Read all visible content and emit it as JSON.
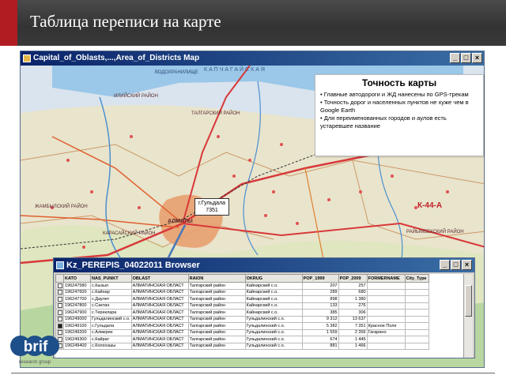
{
  "slide": {
    "title": "Таблица переписи на карте"
  },
  "map_window": {
    "title": "Capital_of_Oblasts,...,Area_of_Districts Map",
    "buttons": [
      "_",
      "□",
      "×"
    ],
    "labels": {
      "region1": "КАПЧАГАЙСКАЯ",
      "region2": "ИЛИЙСКИЙ РАЙОН",
      "region3": "ТАЛГАРСКИЙ РАЙОН",
      "region4": "ЖАМБЫЛСКИЙ РАЙОН",
      "region5": "КАРАСАЙСКИЙ РАЙОН",
      "region6": "РАЙЫМБЕКСКИЙ РАЙОН",
      "city": "АЛМАТЫ",
      "lake": "ВОДОХРАНИЛИЩЕ"
    },
    "road_label": "К-44-А",
    "callout": {
      "line1": "г.Гульдала",
      "line2": "7351"
    }
  },
  "accuracy_note": {
    "title": "Точность карты",
    "bullets": [
      "Главные автодороги и ЖД нанесены по GPS-трекам",
      "Точность дорог и населенных пунктов не хуже чем в Google Earth",
      "Для переименованных городов и аулов есть устаревшее название"
    ]
  },
  "browser_window": {
    "title": "Kz_PEREPIS_04022011 Browser",
    "buttons": [
      "_",
      "□",
      "×"
    ],
    "columns": [
      "KATO",
      "NAS_PUNKT",
      "OBLAST",
      "RAION",
      "OKRUG",
      "POP_1999",
      "POP_2009",
      "FORMERNAME",
      "City_Type"
    ],
    "rows": [
      [
        "196247580",
        "с.Кызыл",
        "АЛМАТИНСКАЯ ОБЛАСТ",
        "Талгарский район",
        "Кайнарский с.о.",
        "207",
        "257",
        "",
        ""
      ],
      [
        "196247600",
        "с.Кайнар",
        "АЛМАТИНСКАЯ ОБЛАСТ",
        "Талгарский район",
        "Кайнарский с.о.",
        "289",
        "680",
        "",
        ""
      ],
      [
        "196247700",
        "с.Даулет",
        "АЛМАТИНСКАЯ ОБЛАСТ",
        "Талгарский район",
        "Кайнарский с.о.",
        "898",
        "1 380",
        "",
        ""
      ],
      [
        "196247800",
        "с.Сактан",
        "АЛМАТИНСКАЯ ОБЛАСТ",
        "Талгарский район",
        "Кайнарский с.о.",
        "133",
        "276",
        "",
        ""
      ],
      [
        "196247900",
        "с.Тереклара",
        "АЛМАТИНСКАЯ ОБЛАСТ",
        "Талгарский район",
        "Кайнарский с.о.",
        "385",
        "306",
        "",
        ""
      ],
      [
        "196249000",
        "Гульдалинский с.о.",
        "АЛМАТИНСКАЯ ОБЛАСТ",
        "Талгарский район",
        "Гульдалинский с.о.",
        "9 312",
        "13 637",
        "",
        ""
      ],
      [
        "196249100",
        "с.Гульдала",
        "АЛМАТИНСКАЯ ОБЛАСТ",
        "Талгарский район",
        "Гульдалинский с.о.",
        "5 382",
        "7 351",
        "Красное Поле",
        ""
      ],
      [
        "196249200",
        "с.Алмерек",
        "АЛМАТИНСКАЯ ОБЛАСТ",
        "Талгарский район",
        "Гульдалинский с.о.",
        "1 559",
        "2 356",
        "Гагарино",
        ""
      ],
      [
        "196249300",
        "с.Кайрат",
        "АЛМАТИНСКАЯ ОБЛАСТ",
        "Талгарский район",
        "Гульдалинский с.о.",
        "674",
        "1 445",
        "",
        ""
      ],
      [
        "196249400",
        "с.Колхозшы",
        "АЛМАТИНСКАЯ ОБЛАСТ",
        "Талгарский район",
        "Гульдалинский с.о.",
        "881",
        "1 466",
        "",
        ""
      ]
    ],
    "selected_row": 6
  },
  "logo": {
    "text": "brif",
    "tagline": "research group"
  },
  "colors": {
    "title_bar": "#3b3b3b",
    "accent_red": "#b01c22",
    "window_title": "#0a246a",
    "road": "#c0202a"
  }
}
